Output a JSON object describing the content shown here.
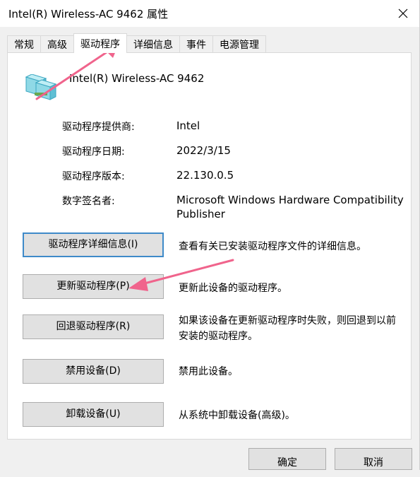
{
  "window": {
    "title": "Intel(R) Wireless-AC 9462 属性"
  },
  "tabs": [
    {
      "label": "常规"
    },
    {
      "label": "高级"
    },
    {
      "label": "驱动程序",
      "active": true
    },
    {
      "label": "详细信息"
    },
    {
      "label": "事件"
    },
    {
      "label": "电源管理"
    }
  ],
  "device": {
    "name": "Intel(R) Wireless-AC 9462",
    "icon": "network-adapter-icon"
  },
  "properties": [
    {
      "label": "驱动程序提供商:",
      "value": "Intel"
    },
    {
      "label": "驱动程序日期:",
      "value": "2022/3/15"
    },
    {
      "label": "驱动程序版本:",
      "value": "22.130.0.5"
    },
    {
      "label": "数字签名者:",
      "value": "Microsoft Windows Hardware Compatibility Publisher"
    }
  ],
  "actions": [
    {
      "label": "驱动程序详细信息(I)",
      "description": "查看有关已安装驱动程序文件的详细信息。"
    },
    {
      "label": "更新驱动程序(P)",
      "description": "更新此设备的驱动程序。"
    },
    {
      "label": "回退驱动程序(R)",
      "description": "如果该设备在更新驱动程序时失败，则回退到以前安装的驱动程序。"
    },
    {
      "label": "禁用设备(D)",
      "description": "禁用此设备。"
    },
    {
      "label": "卸载设备(U)",
      "description": "从系统中卸载设备(高级)。"
    }
  ],
  "dialog_buttons": {
    "ok": "确定",
    "cancel": "取消"
  },
  "colors": {
    "annotation_arrow": "#f0648c",
    "focus_border": "#3e8ac9",
    "panel_bg": "#ffffff",
    "window_bg": "#f0f0f0"
  }
}
